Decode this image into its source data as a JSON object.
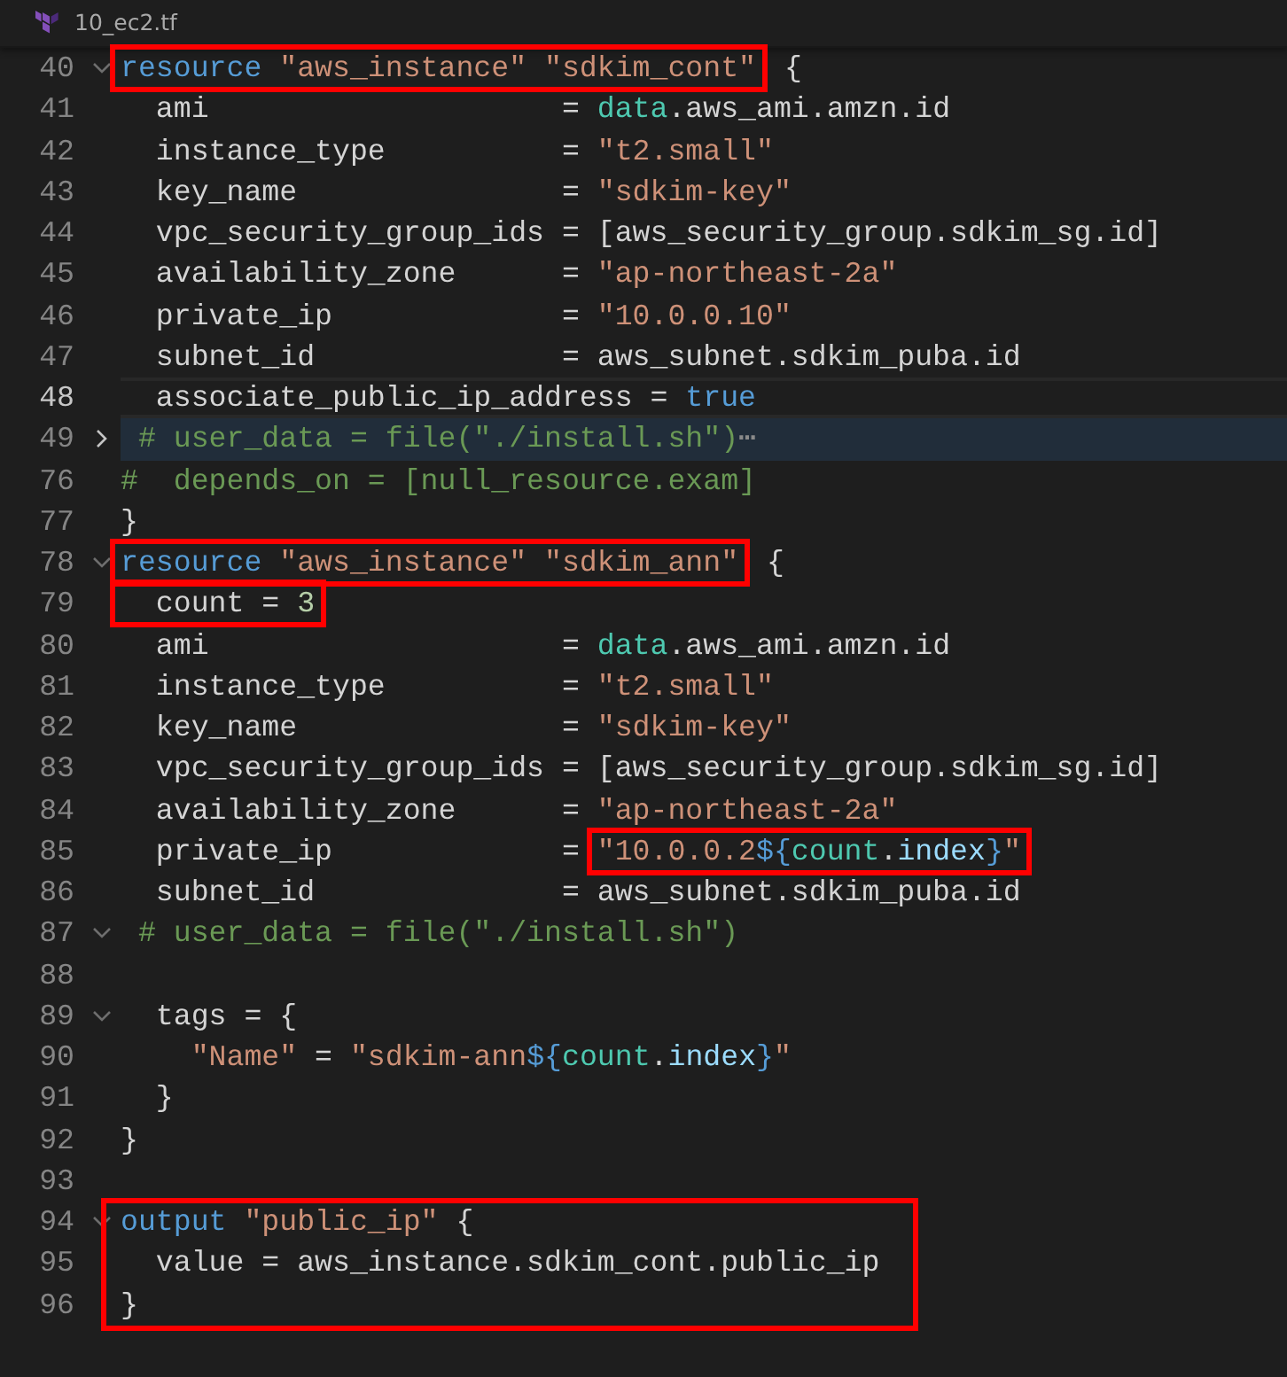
{
  "tab": {
    "filename": "10_ec2.tf"
  },
  "lines": [
    {
      "kind": "line",
      "number": "40",
      "expanded": true,
      "segments": [
        {
          "kind": "highlight",
          "tokens": [
            {
              "kind": "keyword",
              "text": "resource"
            },
            {
              "kind": "string",
              "text": " \"aws_instance\" \"sdkim_cont\""
            }
          ]
        },
        {
          "kind": "code",
          "tokens": [
            {
              "kind": "plain",
              "text": " {"
            }
          ]
        }
      ]
    },
    {
      "kind": "line",
      "number": "41",
      "segments": [
        {
          "kind": "code",
          "tokens": [
            {
              "kind": "plain",
              "text": "  ami                    = "
            },
            {
              "kind": "type",
              "text": "data"
            },
            {
              "kind": "plain",
              "text": ".aws_ami.amzn.id"
            }
          ]
        }
      ]
    },
    {
      "kind": "line",
      "number": "42",
      "segments": [
        {
          "kind": "code",
          "tokens": [
            {
              "kind": "plain",
              "text": "  instance_type          = "
            },
            {
              "kind": "string",
              "text": "\"t2.small\""
            }
          ]
        }
      ]
    },
    {
      "kind": "line",
      "number": "43",
      "segments": [
        {
          "kind": "code",
          "tokens": [
            {
              "kind": "plain",
              "text": "  key_name               = "
            },
            {
              "kind": "string",
              "text": "\"sdkim-key\""
            }
          ]
        }
      ]
    },
    {
      "kind": "line",
      "number": "44",
      "segments": [
        {
          "kind": "code",
          "tokens": [
            {
              "kind": "plain",
              "text": "  vpc_security_group_ids = [aws_security_group.sdkim_sg.id]"
            }
          ]
        }
      ]
    },
    {
      "kind": "line",
      "number": "45",
      "segments": [
        {
          "kind": "code",
          "tokens": [
            {
              "kind": "plain",
              "text": "  availability_zone      = "
            },
            {
              "kind": "string",
              "text": "\"ap-northeast-2a\""
            }
          ]
        }
      ]
    },
    {
      "kind": "line",
      "number": "46",
      "segments": [
        {
          "kind": "code",
          "tokens": [
            {
              "kind": "plain",
              "text": "  private_ip             = "
            },
            {
              "kind": "string",
              "text": "\"10.0.0.10\""
            }
          ]
        }
      ]
    },
    {
      "kind": "line",
      "number": "47",
      "segments": [
        {
          "kind": "code",
          "tokens": [
            {
              "kind": "plain",
              "text": "  subnet_id              = aws_subnet.sdkim_puba.id"
            }
          ]
        }
      ]
    },
    {
      "kind": "current",
      "number": "48",
      "segments": [
        {
          "kind": "code",
          "tokens": [
            {
              "kind": "plain",
              "text": "  associate_public_ip_address = "
            },
            {
              "kind": "keyword",
              "text": "true"
            }
          ]
        }
      ]
    },
    {
      "kind": "folded",
      "number": "49",
      "expanded": false,
      "segments": [
        {
          "kind": "code",
          "tokens": [
            {
              "kind": "comment",
              "text": " # user_data = file(\"./install.sh\")"
            }
          ]
        },
        {
          "kind": "ellipsis",
          "tokens": [
            {
              "kind": "plain",
              "text": "⋯"
            }
          ]
        }
      ]
    },
    {
      "kind": "line",
      "number": "76",
      "segments": [
        {
          "kind": "code",
          "tokens": [
            {
              "kind": "comment",
              "text": "#  depends_on = [null_resource.exam]"
            }
          ]
        }
      ]
    },
    {
      "kind": "line",
      "number": "77",
      "segments": [
        {
          "kind": "code",
          "tokens": [
            {
              "kind": "plain",
              "text": "}"
            }
          ]
        }
      ]
    },
    {
      "kind": "line",
      "number": "78",
      "expanded": true,
      "segments": [
        {
          "kind": "highlight",
          "tokens": [
            {
              "kind": "keyword",
              "text": "resource"
            },
            {
              "kind": "string",
              "text": " \"aws_instance\" \"sdkim_ann\""
            }
          ]
        },
        {
          "kind": "code",
          "tokens": [
            {
              "kind": "plain",
              "text": " {"
            }
          ]
        }
      ]
    },
    {
      "kind": "line",
      "number": "79",
      "segments": [
        {
          "kind": "highlight",
          "tokens": [
            {
              "kind": "plain",
              "text": "  count = "
            },
            {
              "kind": "number",
              "text": "3"
            }
          ]
        }
      ]
    },
    {
      "kind": "line",
      "number": "80",
      "segments": [
        {
          "kind": "code",
          "tokens": [
            {
              "kind": "plain",
              "text": "  ami                    = "
            },
            {
              "kind": "type",
              "text": "data"
            },
            {
              "kind": "plain",
              "text": ".aws_ami.amzn.id"
            }
          ]
        }
      ]
    },
    {
      "kind": "line",
      "number": "81",
      "segments": [
        {
          "kind": "code",
          "tokens": [
            {
              "kind": "plain",
              "text": "  instance_type          = "
            },
            {
              "kind": "string",
              "text": "\"t2.small\""
            }
          ]
        }
      ]
    },
    {
      "kind": "line",
      "number": "82",
      "segments": [
        {
          "kind": "code",
          "tokens": [
            {
              "kind": "plain",
              "text": "  key_name               = "
            },
            {
              "kind": "string",
              "text": "\"sdkim-key\""
            }
          ]
        }
      ]
    },
    {
      "kind": "line",
      "number": "83",
      "segments": [
        {
          "kind": "code",
          "tokens": [
            {
              "kind": "plain",
              "text": "  vpc_security_group_ids = [aws_security_group.sdkim_sg.id]"
            }
          ]
        }
      ]
    },
    {
      "kind": "line",
      "number": "84",
      "segments": [
        {
          "kind": "code",
          "tokens": [
            {
              "kind": "plain",
              "text": "  availability_zone      = "
            },
            {
              "kind": "string",
              "text": "\"ap-northeast-2a\""
            }
          ]
        }
      ]
    },
    {
      "kind": "line",
      "number": "85",
      "segments": [
        {
          "kind": "code",
          "tokens": [
            {
              "kind": "plain",
              "text": "  private_ip             = "
            }
          ]
        },
        {
          "kind": "highlight",
          "tokens": [
            {
              "kind": "string",
              "text": "\"10.0.0.2"
            },
            {
              "kind": "interp",
              "text": "${"
            },
            {
              "kind": "type",
              "text": "count"
            },
            {
              "kind": "plain",
              "text": "."
            },
            {
              "kind": "property",
              "text": "index"
            },
            {
              "kind": "interp",
              "text": "}"
            },
            {
              "kind": "string",
              "text": "\""
            }
          ]
        }
      ]
    },
    {
      "kind": "line",
      "number": "86",
      "segments": [
        {
          "kind": "code",
          "tokens": [
            {
              "kind": "plain",
              "text": "  subnet_id              = aws_subnet.sdkim_puba.id"
            }
          ]
        }
      ]
    },
    {
      "kind": "line",
      "number": "87",
      "expanded": true,
      "segments": [
        {
          "kind": "code",
          "tokens": [
            {
              "kind": "comment",
              "text": " # user_data = file(\"./install.sh\")"
            }
          ]
        }
      ]
    },
    {
      "kind": "line",
      "number": "88"
    },
    {
      "kind": "line",
      "number": "89",
      "expanded": true,
      "segments": [
        {
          "kind": "code",
          "tokens": [
            {
              "kind": "plain",
              "text": "  tags = {"
            }
          ]
        }
      ]
    },
    {
      "kind": "line",
      "number": "90",
      "segments": [
        {
          "kind": "code",
          "tokens": [
            {
              "kind": "string",
              "text": "    \"Name\""
            },
            {
              "kind": "plain",
              "text": " = "
            },
            {
              "kind": "string",
              "text": "\"sdkim-ann"
            },
            {
              "kind": "interp",
              "text": "${"
            },
            {
              "kind": "type",
              "text": "count"
            },
            {
              "kind": "plain",
              "text": "."
            },
            {
              "kind": "property",
              "text": "index"
            },
            {
              "kind": "interp",
              "text": "}"
            },
            {
              "kind": "string",
              "text": "\""
            }
          ]
        }
      ]
    },
    {
      "kind": "line",
      "number": "91",
      "segments": [
        {
          "kind": "code",
          "tokens": [
            {
              "kind": "plain",
              "text": "  }"
            }
          ]
        }
      ]
    },
    {
      "kind": "line",
      "number": "92",
      "segments": [
        {
          "kind": "code",
          "tokens": [
            {
              "kind": "plain",
              "text": "}"
            }
          ]
        }
      ]
    },
    {
      "kind": "line",
      "number": "93"
    },
    {
      "kind": "highlight_group",
      "lines": [
        {
          "kind": "line",
          "number": "94",
          "expanded": true,
          "segments": [
            {
              "kind": "code",
              "tokens": [
                {
                  "kind": "keyword",
                  "text": "output"
                },
                {
                  "kind": "string",
                  "text": " \"public_ip\""
                },
                {
                  "kind": "plain",
                  "text": " {"
                }
              ]
            }
          ]
        },
        {
          "kind": "line",
          "number": "95",
          "segments": [
            {
              "kind": "code",
              "tokens": [
                {
                  "kind": "plain",
                  "text": "  value = aws_instance.sdkim_cont.public_ip"
                }
              ]
            }
          ]
        },
        {
          "kind": "line",
          "number": "96",
          "segments": [
            {
              "kind": "code",
              "tokens": [
                {
                  "kind": "plain",
                  "text": "}"
                }
              ]
            }
          ]
        }
      ]
    }
  ]
}
